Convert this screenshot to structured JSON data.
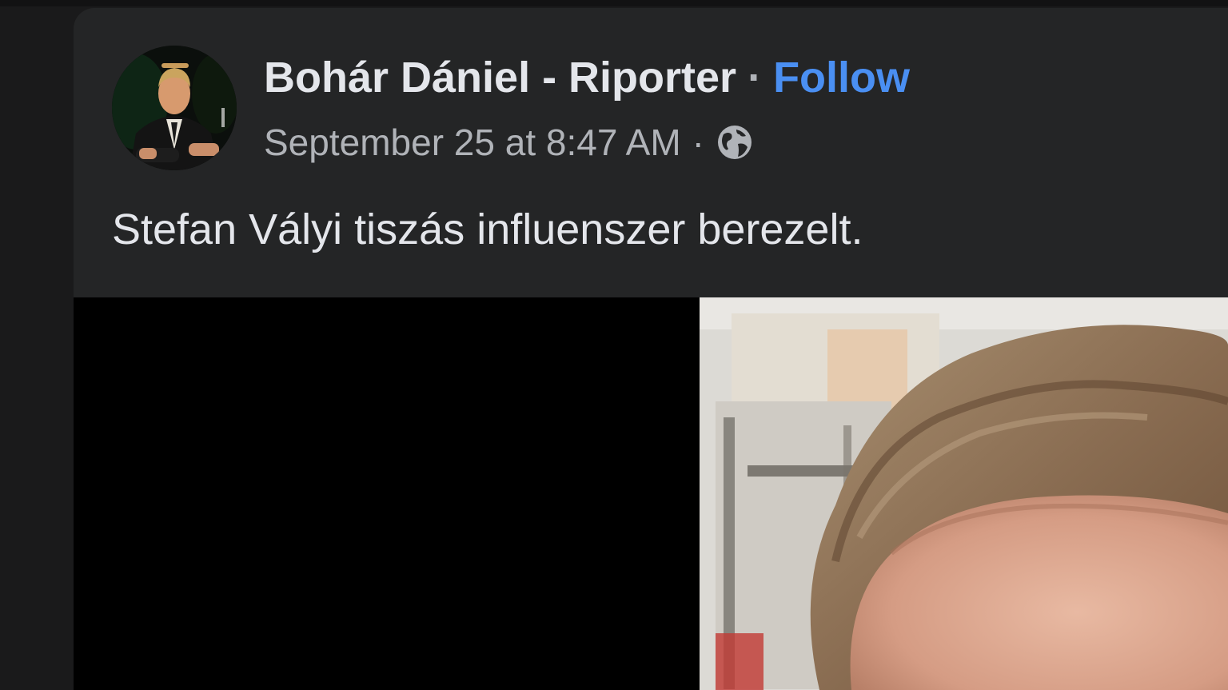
{
  "post": {
    "author": "Bohár Dániel - Riporter",
    "separator": "·",
    "follow_label": "Follow",
    "timestamp": "September 25 at 8:47 AM",
    "meta_separator": "·",
    "audience_icon": "globe-icon",
    "text": "Stefan Vályi tiszás influenszer berezelt."
  },
  "colors": {
    "background": "#1a1a1b",
    "card": "#242526",
    "primary_text": "#e4e6eb",
    "secondary_text": "#b0b3b8",
    "link": "#4a8ff2"
  }
}
